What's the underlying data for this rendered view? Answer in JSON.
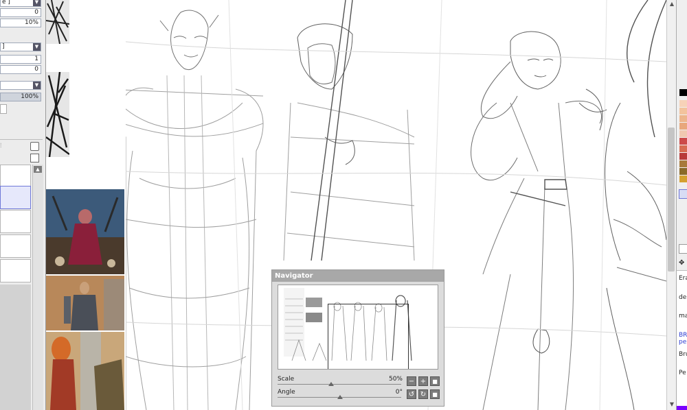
{
  "tool_panel": {
    "mode_dropdown": "e ]",
    "value_a": "0",
    "value_b": "10%",
    "blend_dropdown": "]",
    "value_c": "1",
    "value_d": "0",
    "opacity": "100%"
  },
  "navigator": {
    "title": "Navigator",
    "scale_label": "Scale",
    "scale_value": "50%",
    "angle_label": "Angle",
    "angle_value": "0°"
  },
  "right_panel": {
    "labels": [
      "Era",
      "de",
      "ma",
      "BR",
      "pe",
      "Bru",
      "Pe"
    ],
    "palette": [
      "#000000",
      "#f7d2b8",
      "#f3c39d",
      "#edb58c",
      "#e8a77c",
      "#f0c8b0",
      "#cc4a4a",
      "#d66b52",
      "#b83a3a",
      "#a87a3a",
      "#8a6a2a",
      "#d4a030"
    ],
    "accent": "#7a00ff"
  },
  "colors": {
    "panel_bg": "#ececec",
    "selected_layer": "#e6e8fb",
    "navigator_title_bg": "#a8a8a8"
  }
}
